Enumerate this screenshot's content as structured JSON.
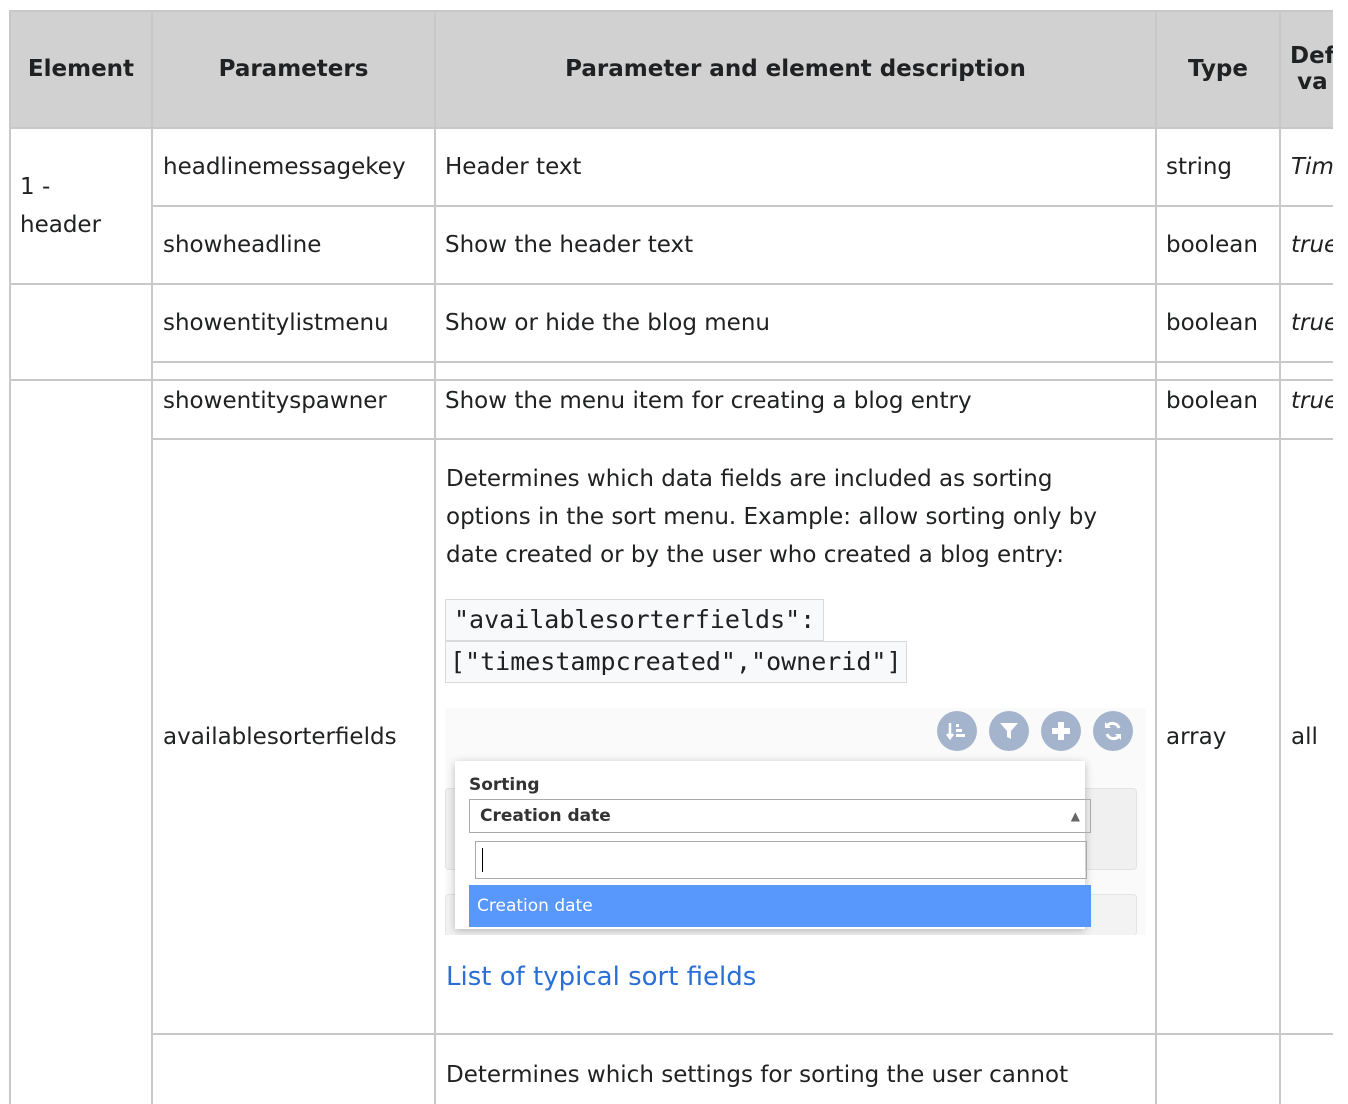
{
  "headers": {
    "element": "Element",
    "parameters": "Parameters",
    "description": "Parameter and element description",
    "type": "Type",
    "default_l1": "Def",
    "default_l2": "va"
  },
  "rows": [
    {
      "element_l1": "1 -",
      "element_l2": "header",
      "param": "headlinemessagekey",
      "desc": "Header text",
      "type": "string",
      "default": "Tim"
    },
    {
      "param": "showheadline",
      "desc": "Show the header text",
      "type": "boolean",
      "default": "true"
    },
    {
      "param": "showentitylistmenu",
      "desc": "Show or hide the blog menu",
      "type": "boolean",
      "default": "true"
    },
    {
      "param": "showentityspawner",
      "desc": "Show the menu item for creating a blog entry",
      "type": "boolean",
      "default": "true"
    },
    {
      "param": "availablesorterfields",
      "desc_l1": "Determines which data fields are included as sorting",
      "desc_l2": "options in the sort menu. Example: allow sorting only by",
      "desc_l3": "date created or by the user who created a blog entry:",
      "code_l1": "\"availablesorterfields\":",
      "code_l2": "[\"timestampcreated\",\"ownerid\"]",
      "link": "List of typical sort fields",
      "type": "array",
      "default": "all"
    },
    {
      "desc": "Determines which settings for sorting the user cannot"
    }
  ],
  "screenshot": {
    "sorting_label": "Sorting",
    "selected": "Creation date",
    "option": "Creation date",
    "icons": [
      "sort-icon",
      "filter-icon",
      "plus-icon",
      "refresh-icon"
    ]
  }
}
